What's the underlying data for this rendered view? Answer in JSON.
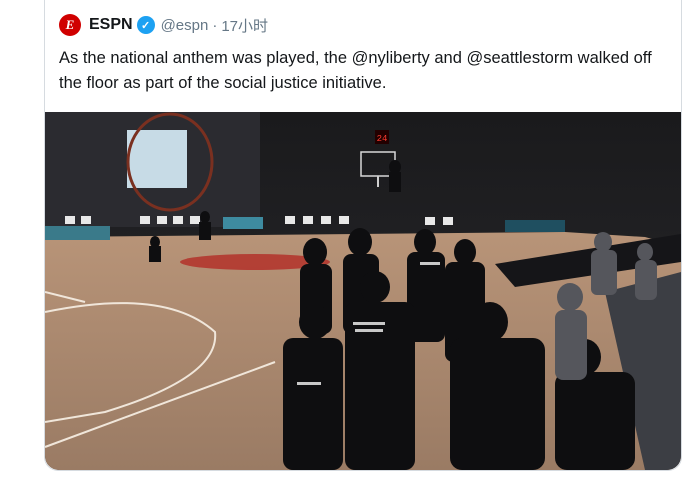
{
  "tweet": {
    "author_name": "ESPN",
    "handle": "@espn",
    "separator": "·",
    "time": "17小时",
    "logo_letter": "E",
    "text": "As the national anthem was played, the @nyliberty and @seattlestorm walked off the floor as part of the social justice initiative.",
    "brand_color": "#d00000",
    "verified_color": "#1da1f2"
  },
  "media": {
    "shot_clock": "24",
    "icon": "media-photo"
  }
}
